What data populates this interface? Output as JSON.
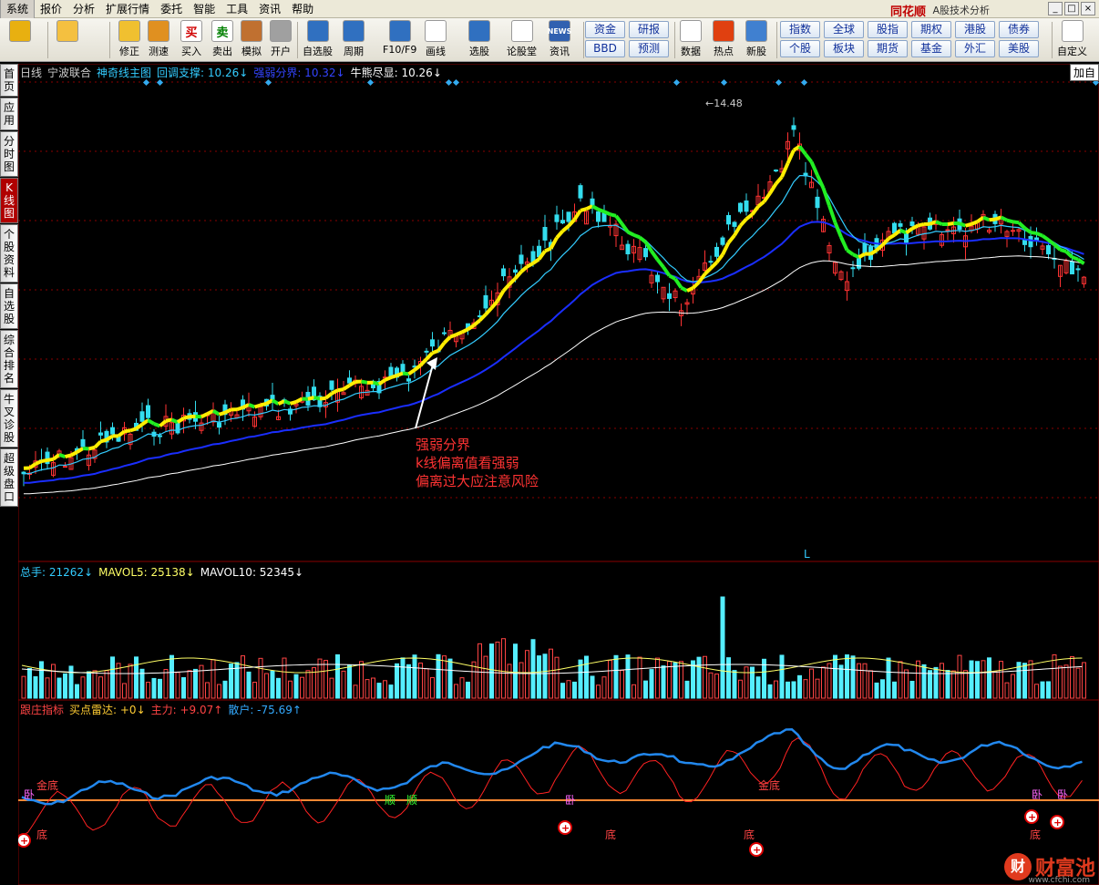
{
  "menu": [
    "系统",
    "报价",
    "分析",
    "扩展行情",
    "委托",
    "智能",
    "工具",
    "资讯",
    "帮助"
  ],
  "app": {
    "brand": "同花顺",
    "title": "A股技术分析"
  },
  "toolbar": {
    "buttons": [
      {
        "label": "",
        "icon": "color-grid-icon",
        "bg": "#e8b010"
      },
      {
        "label": "",
        "icon": "back-arrow-icon",
        "bg": "#f4c040"
      },
      {
        "label": "修正",
        "icon": "up-down-arrow-icon",
        "bg": "#f0c030"
      },
      {
        "label": "测速",
        "icon": "clock-icon",
        "bg": "#e09020"
      },
      {
        "label": "买入",
        "icon": "buy-icon",
        "bg": "#ffffff",
        "glyph": "买",
        "color": "#d00000"
      },
      {
        "label": "卖出",
        "icon": "sell-icon",
        "bg": "#ffffff",
        "glyph": "卖",
        "color": "#008000"
      },
      {
        "label": "模拟",
        "icon": "hammer-icon",
        "bg": "#c07030"
      },
      {
        "label": "开户",
        "icon": "lock-icon",
        "bg": "#a0a0a0"
      },
      {
        "label": "自选股",
        "icon": "star-icon",
        "bg": "#3070c0"
      },
      {
        "label": "周期",
        "icon": "cycle-icon",
        "bg": "#3070c0"
      },
      {
        "label": "F10/F9",
        "icon": "f10-icon",
        "bg": "#3070c0"
      },
      {
        "label": "画线",
        "icon": "pencil-icon",
        "bg": "#ffffff"
      },
      {
        "label": "选股",
        "icon": "select-stock-icon",
        "bg": "#3070c0"
      },
      {
        "label": "论股堂",
        "icon": "forum-icon",
        "bg": "#ffffff"
      },
      {
        "label": "资讯",
        "icon": "news-icon",
        "bg": "#3060b0",
        "glyph": "NEWS"
      },
      {
        "label": "数据",
        "icon": "pe-icon",
        "bg": "#ffffff",
        "glyph": "PE"
      },
      {
        "label": "热点",
        "icon": "hot-icon",
        "bg": "#e04010"
      },
      {
        "label": "新股",
        "icon": "ipo-icon",
        "bg": "#4080d0"
      },
      {
        "label": "自定义",
        "icon": "customize-icon",
        "bg": "#ffffff"
      }
    ],
    "grid1": [
      "资金",
      "研报",
      "BBD",
      "预测"
    ],
    "grid2": [
      "指数",
      "全球",
      "股指",
      "期权",
      "港股",
      "债券",
      "个股",
      "板块",
      "期货",
      "基金",
      "外汇",
      "美股"
    ]
  },
  "sidetabs": [
    "首页",
    "应用",
    "分时图",
    "K线图",
    "个股资料",
    "自选股",
    "综合排名",
    "牛叉诊股",
    "超级盘口"
  ],
  "sidetab_active": "K线图",
  "main_legend": [
    {
      "text": "日线",
      "color": "#cccccc"
    },
    {
      "text": "宁波联合",
      "color": "#cccccc"
    },
    {
      "text": "神奇线主图",
      "color": "#33ccff"
    },
    {
      "text": "回调支撑: 10.26↓",
      "color": "#33ccff"
    },
    {
      "text": "强弱分界: 10.32↓",
      "color": "#3344ff"
    },
    {
      "text": "牛熊尽显: 10.26↓",
      "color": "#ffffff"
    }
  ],
  "add_button": "加自",
  "peak_label": "←14.48",
  "marker_L": "L",
  "annotation": [
    "强弱分界",
    "k线偏离值看强弱",
    "偏离过大应注意风险"
  ],
  "vol_legend": [
    {
      "text": "总手: 21262↓",
      "color": "#33ccff"
    },
    {
      "text": "MAVOL5: 25138↓",
      "color": "#ffff66"
    },
    {
      "text": "MAVOL10: 52345↓",
      "color": "#ffffff"
    }
  ],
  "ind_legend": [
    {
      "text": "跟庄指标",
      "color": "#ff4444"
    },
    {
      "text": "买点雷达: +0↓",
      "color": "#ffcc33"
    },
    {
      "text": "主力: +9.07↑",
      "color": "#ff4444"
    },
    {
      "text": "散户: -75.69↑",
      "color": "#33aaff"
    }
  ],
  "ind_labels": {
    "gold_bottom": "金底",
    "sell": "卧",
    "bottom": "底",
    "trend": "顺"
  },
  "watermark": {
    "logo": "财",
    "text": "财富池",
    "url": "www.cfchi.com"
  },
  "colors": {
    "up": "#ff3333",
    "down": "#33ddee",
    "ma_cyan": "#33ccff",
    "ma_blue": "#1a2eff",
    "ma_white": "#ffffff",
    "volume_up": "#ff4444",
    "volume_down": "#55eeff",
    "grid": "#8a0000"
  }
}
